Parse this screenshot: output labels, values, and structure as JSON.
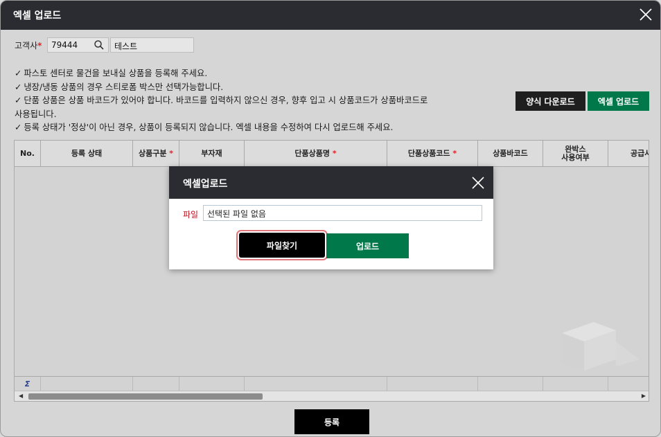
{
  "window": {
    "title": "엑셀 업로드"
  },
  "customer": {
    "label": "고객사",
    "code": "79444",
    "name": "테스트"
  },
  "notes": [
    "파스토 센터로 물건을 보내실 상품을 등록해 주세요.",
    "냉장/냉동 상품의 경우 스티로폼 박스만 선택가능합니다.",
    "단품 상품은 상품 바코드가 있어야 합니다. 바코드를 입력하지 않으신 경우, 향후 입고 시 상품코드가 상품바코드로",
    "사용됩니다.",
    "등록 상태가 '정상'이 아닌 경우, 상품이 등록되지 않습니다. 엑셀 내용을 수정하여 다시 업로드해 주세요."
  ],
  "buttons": {
    "template_download": "양식 다운로드",
    "excel_upload": "엑셀 업로드",
    "register": "등록"
  },
  "grid": {
    "columns": [
      "No.",
      "등록 상태",
      "상품구분",
      "부자재",
      "단품상품명",
      "단품상품코드",
      "상품바코드",
      "완박스 사용여부",
      "공급사"
    ],
    "required": [
      false,
      false,
      true,
      false,
      true,
      true,
      false,
      false,
      false
    ],
    "footer_symbol": "Σ"
  },
  "modal": {
    "title": "엑셀업로드",
    "file_label": "파일",
    "file_value": "선택된 파일 없음",
    "browse_label": "파일찾기",
    "upload_label": "업로드"
  },
  "colors": {
    "titlebar": "#2a2c31",
    "green": "#00784a",
    "dark_button": "#1f1f1f",
    "required": "#e0202a"
  }
}
